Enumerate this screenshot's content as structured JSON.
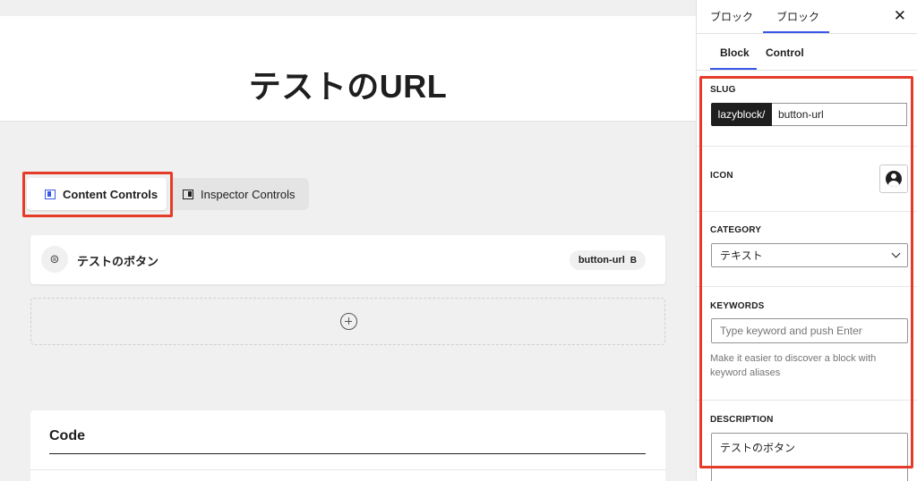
{
  "editor": {
    "page_title": "テストのURL",
    "tabs": {
      "content": "Content Controls",
      "inspector": "Inspector Controls"
    },
    "control": {
      "label": "テストのボタン",
      "badge": "button-url",
      "badge_icon": "B"
    },
    "code": {
      "title": "Code"
    }
  },
  "sidebar": {
    "tabs": [
      "ブロック",
      "ブロック"
    ],
    "close": "✕",
    "sub_tabs": [
      "Block",
      "Control"
    ],
    "slug": {
      "label": "SLUG",
      "prefix": "lazyblock/",
      "value": "button-url"
    },
    "icon": {
      "label": "ICON"
    },
    "category": {
      "label": "CATEGORY",
      "value": "テキスト"
    },
    "keywords": {
      "label": "KEYWORDS",
      "placeholder": "Type keyword and push Enter",
      "help": "Make it easier to discover a block with keyword aliases"
    },
    "description": {
      "label": "DESCRIPTION",
      "value": "テストのボタン"
    }
  },
  "colors": {
    "accent": "#3858e9",
    "highlight": "#e53c2a"
  }
}
